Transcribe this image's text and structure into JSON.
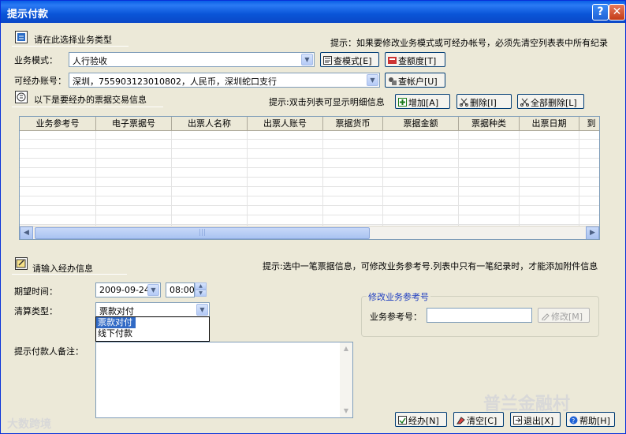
{
  "window": {
    "title": "提示付款",
    "help_btn": "?",
    "close_btn": "✕"
  },
  "section1": {
    "heading": "请在此选择业务类型",
    "hint": "提示：如果要修改业务模式或可经办帐号，必须先清空列表表中所有纪录"
  },
  "business_mode": {
    "label": "业务模式：",
    "value": "人行验收",
    "btn_query_mode": "查模式[E]",
    "btn_query_quota": "查额度[T]"
  },
  "account": {
    "label": "可经办账号：",
    "value": "深圳，755903123010802，人民币，深圳蛇口支行",
    "btn_query_account": "查帐户[U]"
  },
  "section2": {
    "heading": "以下是要经办的票据交易信息",
    "hint": "提示:双击列表可显示明细信息",
    "btn_add": "增加[A]",
    "btn_delete": "删除[I]",
    "btn_delete_all": "全部删除[L]"
  },
  "table": {
    "columns": [
      "业务参考号",
      "电子票据号",
      "出票人名称",
      "出票人账号",
      "票据货币",
      "票据金额",
      "票据种类",
      "出票日期",
      "到"
    ]
  },
  "section3": {
    "heading": "请输入经办信息",
    "hint": "提示:选中一笔票据信息，可修改业务参考号.列表中只有一笔纪录时，才能添加附件信息"
  },
  "expected_time": {
    "label": "期望时间：",
    "date": "2009-09-24",
    "time": "08:00"
  },
  "settlement": {
    "label": "清算类型：",
    "value": "票款对付",
    "options": [
      "票款对付",
      "线下付款"
    ]
  },
  "modify_ref": {
    "legend": "修改业务参考号",
    "label": "业务参考号：",
    "value": "",
    "btn_modify": "修改[M]"
  },
  "remarks": {
    "label": "提示付款人备注："
  },
  "footer": {
    "btn_submit": "经办[N]",
    "btn_clear": "清空[C]",
    "btn_exit": "退出[X]",
    "btn_help": "帮助[H]"
  },
  "watermarks": {
    "left": "大数跨境",
    "right": "普兰金融村"
  }
}
